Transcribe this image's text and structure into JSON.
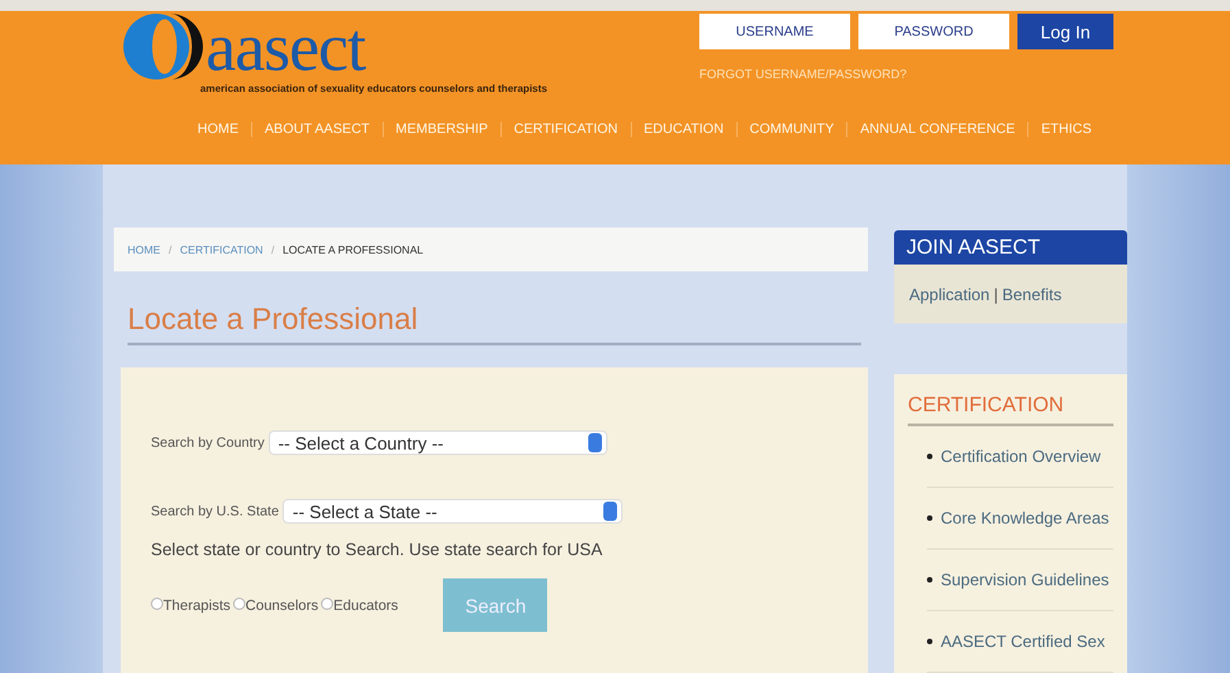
{
  "header": {
    "logo_text": "aasect",
    "tagline": "american association of sexuality educators counselors and therapists",
    "login": {
      "username_placeholder": "USERNAME",
      "password_placeholder": "PASSWORD",
      "button": "Log In",
      "forgot": "FORGOT USERNAME/PASSWORD?"
    },
    "nav": [
      "HOME",
      "ABOUT AASECT",
      "MEMBERSHIP",
      "CERTIFICATION",
      "EDUCATION",
      "COMMUNITY",
      "ANNUAL CONFERENCE",
      "ETHICS"
    ]
  },
  "breadcrumb": [
    {
      "label": "HOME",
      "current": false
    },
    {
      "label": "CERTIFICATION",
      "current": false
    },
    {
      "label": "LOCATE A PROFESSIONAL",
      "current": true
    }
  ],
  "breadcrumb_separator": "/",
  "page_title": "Locate a Professional",
  "search_form": {
    "fields": [
      {
        "label": "Search by Country",
        "value": "-- Select a Country --"
      },
      {
        "label": "Search by U.S. State",
        "value": "-- Select a State --"
      }
    ],
    "hint": "Select state or country to Search. Use state search for USA",
    "options": [
      {
        "label": "Therapists",
        "checked": false
      },
      {
        "label": "Counselors",
        "checked": false
      },
      {
        "label": "Educators",
        "checked": false
      }
    ],
    "button": "Search"
  },
  "sidebar": {
    "join": {
      "title": "JOIN AASECT",
      "links": [
        "Application",
        "Benefits"
      ],
      "separator": "|"
    },
    "certification": {
      "title": "CERTIFICATION",
      "items": [
        "Certification Overview",
        "Core Knowledge Areas",
        "Supervision Guidelines",
        "AASECT Certified Sex"
      ]
    }
  }
}
